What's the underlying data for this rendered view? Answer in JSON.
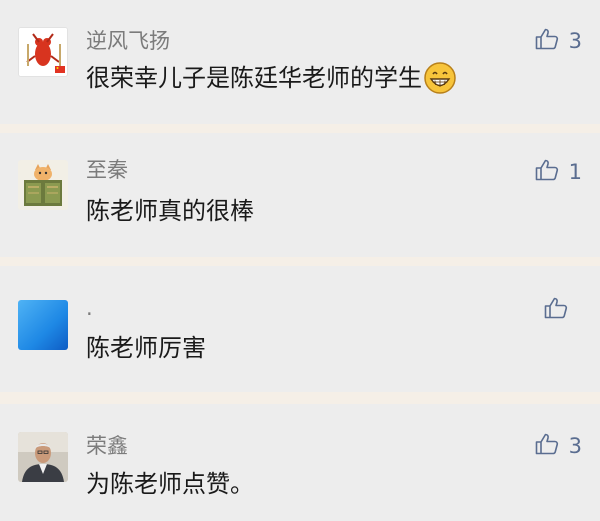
{
  "comments": [
    {
      "nickname": "逆风飞扬",
      "text": "很荣幸儿子是陈廷华老师的学生",
      "emoji": "grinning-face-emoji",
      "likes": "3",
      "avatar": "crayfish-avatar"
    },
    {
      "nickname": "至秦",
      "text": "陈老师真的很棒",
      "likes": "1",
      "avatar": "cat-with-books-avatar"
    },
    {
      "nickname": ".",
      "text": "陈老师厉害",
      "likes": "",
      "avatar": "blue-gradient-avatar"
    },
    {
      "nickname": "荣鑫",
      "text": "为陈老师点赞。",
      "likes": "3",
      "avatar": "man-portrait-avatar"
    }
  ],
  "icons": {
    "like": "thumbs-up-icon"
  },
  "colors": {
    "card_background": "#ededed",
    "separator": "#f5efe7",
    "nickname": "#7b7b7b",
    "like_accent": "#5a6d90"
  }
}
